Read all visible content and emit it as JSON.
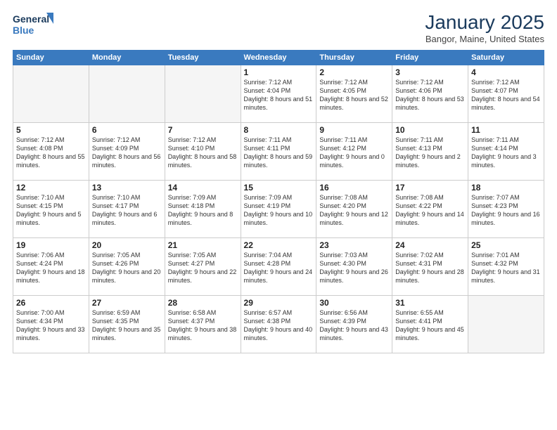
{
  "header": {
    "logo_line1": "General",
    "logo_line2": "Blue",
    "title": "January 2025",
    "location": "Bangor, Maine, United States"
  },
  "weekdays": [
    "Sunday",
    "Monday",
    "Tuesday",
    "Wednesday",
    "Thursday",
    "Friday",
    "Saturday"
  ],
  "weeks": [
    [
      {
        "day": "",
        "info": ""
      },
      {
        "day": "",
        "info": ""
      },
      {
        "day": "",
        "info": ""
      },
      {
        "day": "1",
        "info": "Sunrise: 7:12 AM\nSunset: 4:04 PM\nDaylight: 8 hours and 51 minutes."
      },
      {
        "day": "2",
        "info": "Sunrise: 7:12 AM\nSunset: 4:05 PM\nDaylight: 8 hours and 52 minutes."
      },
      {
        "day": "3",
        "info": "Sunrise: 7:12 AM\nSunset: 4:06 PM\nDaylight: 8 hours and 53 minutes."
      },
      {
        "day": "4",
        "info": "Sunrise: 7:12 AM\nSunset: 4:07 PM\nDaylight: 8 hours and 54 minutes."
      }
    ],
    [
      {
        "day": "5",
        "info": "Sunrise: 7:12 AM\nSunset: 4:08 PM\nDaylight: 8 hours and 55 minutes."
      },
      {
        "day": "6",
        "info": "Sunrise: 7:12 AM\nSunset: 4:09 PM\nDaylight: 8 hours and 56 minutes."
      },
      {
        "day": "7",
        "info": "Sunrise: 7:12 AM\nSunset: 4:10 PM\nDaylight: 8 hours and 58 minutes."
      },
      {
        "day": "8",
        "info": "Sunrise: 7:11 AM\nSunset: 4:11 PM\nDaylight: 8 hours and 59 minutes."
      },
      {
        "day": "9",
        "info": "Sunrise: 7:11 AM\nSunset: 4:12 PM\nDaylight: 9 hours and 0 minutes."
      },
      {
        "day": "10",
        "info": "Sunrise: 7:11 AM\nSunset: 4:13 PM\nDaylight: 9 hours and 2 minutes."
      },
      {
        "day": "11",
        "info": "Sunrise: 7:11 AM\nSunset: 4:14 PM\nDaylight: 9 hours and 3 minutes."
      }
    ],
    [
      {
        "day": "12",
        "info": "Sunrise: 7:10 AM\nSunset: 4:15 PM\nDaylight: 9 hours and 5 minutes."
      },
      {
        "day": "13",
        "info": "Sunrise: 7:10 AM\nSunset: 4:17 PM\nDaylight: 9 hours and 6 minutes."
      },
      {
        "day": "14",
        "info": "Sunrise: 7:09 AM\nSunset: 4:18 PM\nDaylight: 9 hours and 8 minutes."
      },
      {
        "day": "15",
        "info": "Sunrise: 7:09 AM\nSunset: 4:19 PM\nDaylight: 9 hours and 10 minutes."
      },
      {
        "day": "16",
        "info": "Sunrise: 7:08 AM\nSunset: 4:20 PM\nDaylight: 9 hours and 12 minutes."
      },
      {
        "day": "17",
        "info": "Sunrise: 7:08 AM\nSunset: 4:22 PM\nDaylight: 9 hours and 14 minutes."
      },
      {
        "day": "18",
        "info": "Sunrise: 7:07 AM\nSunset: 4:23 PM\nDaylight: 9 hours and 16 minutes."
      }
    ],
    [
      {
        "day": "19",
        "info": "Sunrise: 7:06 AM\nSunset: 4:24 PM\nDaylight: 9 hours and 18 minutes."
      },
      {
        "day": "20",
        "info": "Sunrise: 7:05 AM\nSunset: 4:26 PM\nDaylight: 9 hours and 20 minutes."
      },
      {
        "day": "21",
        "info": "Sunrise: 7:05 AM\nSunset: 4:27 PM\nDaylight: 9 hours and 22 minutes."
      },
      {
        "day": "22",
        "info": "Sunrise: 7:04 AM\nSunset: 4:28 PM\nDaylight: 9 hours and 24 minutes."
      },
      {
        "day": "23",
        "info": "Sunrise: 7:03 AM\nSunset: 4:30 PM\nDaylight: 9 hours and 26 minutes."
      },
      {
        "day": "24",
        "info": "Sunrise: 7:02 AM\nSunset: 4:31 PM\nDaylight: 9 hours and 28 minutes."
      },
      {
        "day": "25",
        "info": "Sunrise: 7:01 AM\nSunset: 4:32 PM\nDaylight: 9 hours and 31 minutes."
      }
    ],
    [
      {
        "day": "26",
        "info": "Sunrise: 7:00 AM\nSunset: 4:34 PM\nDaylight: 9 hours and 33 minutes."
      },
      {
        "day": "27",
        "info": "Sunrise: 6:59 AM\nSunset: 4:35 PM\nDaylight: 9 hours and 35 minutes."
      },
      {
        "day": "28",
        "info": "Sunrise: 6:58 AM\nSunset: 4:37 PM\nDaylight: 9 hours and 38 minutes."
      },
      {
        "day": "29",
        "info": "Sunrise: 6:57 AM\nSunset: 4:38 PM\nDaylight: 9 hours and 40 minutes."
      },
      {
        "day": "30",
        "info": "Sunrise: 6:56 AM\nSunset: 4:39 PM\nDaylight: 9 hours and 43 minutes."
      },
      {
        "day": "31",
        "info": "Sunrise: 6:55 AM\nSunset: 4:41 PM\nDaylight: 9 hours and 45 minutes."
      },
      {
        "day": "",
        "info": ""
      }
    ]
  ]
}
